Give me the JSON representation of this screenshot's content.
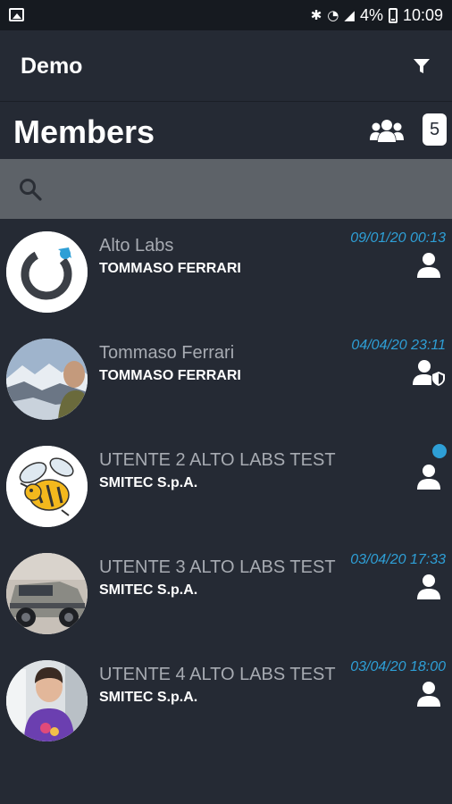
{
  "status_bar": {
    "icons": [
      "picture-icon",
      "bluetooth-icon",
      "wifi-icon",
      "signal-icon",
      "battery-icon"
    ],
    "bluetooth_glyph": "✱",
    "wifi_glyph": "◔",
    "signal_glyph": "◢",
    "battery_percent": "4%",
    "time": "10:09"
  },
  "app_bar": {
    "title": "Demo",
    "filter_icon": "filter-icon"
  },
  "members_header": {
    "title": "Members",
    "group_icon": "group-icon",
    "count": "5"
  },
  "search": {
    "value": "",
    "placeholder": "",
    "icon": "search-icon"
  },
  "members": [
    {
      "name": "Alto Labs",
      "company": "TOMMASO FERRARI",
      "date": "09/01/20 00:13",
      "role_icon": "user-icon",
      "online": false,
      "avatar": "alto-labs-logo"
    },
    {
      "name": "Tommaso Ferrari",
      "company": "TOMMASO FERRARI",
      "date": "04/04/20 23:11",
      "role_icon": "user-shield-icon",
      "online": false,
      "avatar": "photo-man-mountains"
    },
    {
      "name": "UTENTE 2 ALTO LABS TEST",
      "company": "SMITEC S.p.A.",
      "date": "",
      "role_icon": "user-icon",
      "online": true,
      "avatar": "bee-cartoon"
    },
    {
      "name": "UTENTE 3 ALTO LABS TEST",
      "company": "SMITEC S.p.A.",
      "date": "03/04/20 17:33",
      "role_icon": "user-icon",
      "online": false,
      "avatar": "photo-car"
    },
    {
      "name": "UTENTE 4 ALTO LABS TEST",
      "company": "SMITEC S.p.A.",
      "date": "03/04/20 18:00",
      "role_icon": "user-icon",
      "online": false,
      "avatar": "photo-young-man"
    }
  ],
  "colors": {
    "background": "#252a34",
    "status_bar": "#161a20",
    "search_bar": "#5d6268",
    "accent_blue": "#2e9fd6",
    "secondary_text": "#a7abb2"
  }
}
